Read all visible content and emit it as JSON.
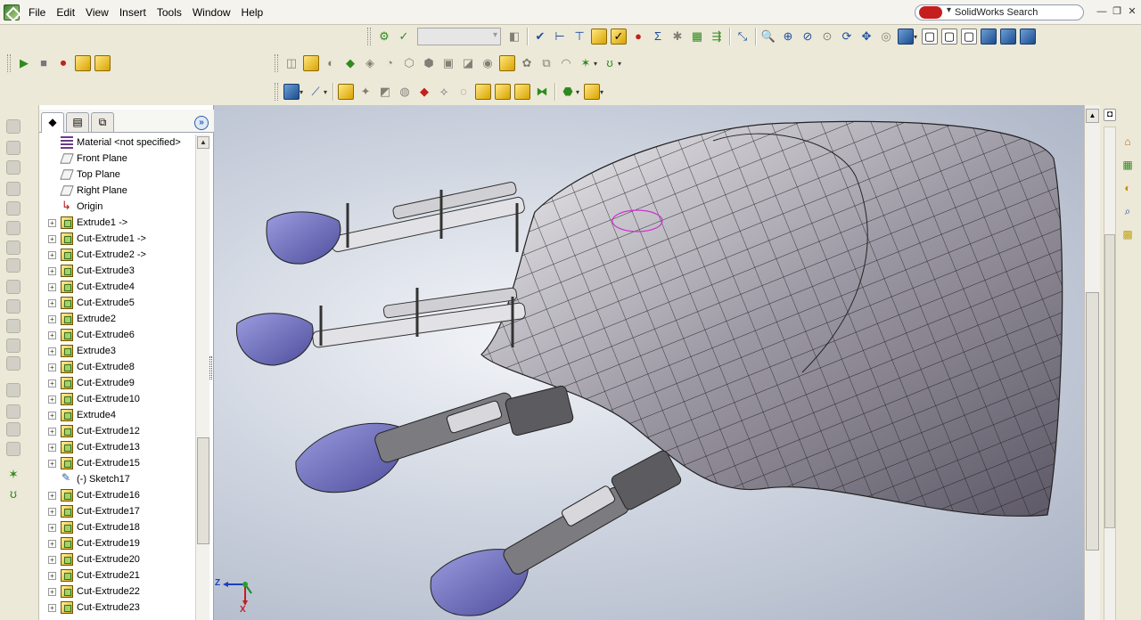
{
  "menu": {
    "items": [
      "File",
      "Edit",
      "View",
      "Insert",
      "Tools",
      "Window",
      "Help"
    ],
    "search_placeholder": "SolidWorks Search"
  },
  "window_controls": {
    "minimize": "—",
    "restore": "❐",
    "close": "✕"
  },
  "toolbar": {
    "configuration_combo": ""
  },
  "feature_tree": {
    "items": [
      {
        "label": "Material <not specified>",
        "icon": "material-icon",
        "expandable": false
      },
      {
        "label": "Front Plane",
        "icon": "plane-icon",
        "expandable": false
      },
      {
        "label": "Top Plane",
        "icon": "plane-icon",
        "expandable": false
      },
      {
        "label": "Right Plane",
        "icon": "plane-icon",
        "expandable": false
      },
      {
        "label": "Origin",
        "icon": "origin-icon",
        "expandable": false
      },
      {
        "label": "Extrude1 ->",
        "icon": "extrude-icon",
        "expandable": true
      },
      {
        "label": "Cut-Extrude1 ->",
        "icon": "cut-extrude-icon",
        "expandable": true
      },
      {
        "label": "Cut-Extrude2 ->",
        "icon": "cut-extrude-icon",
        "expandable": true
      },
      {
        "label": "Cut-Extrude3",
        "icon": "cut-extrude-icon",
        "expandable": true
      },
      {
        "label": "Cut-Extrude4",
        "icon": "cut-extrude-icon",
        "expandable": true
      },
      {
        "label": "Cut-Extrude5",
        "icon": "cut-extrude-icon",
        "expandable": true
      },
      {
        "label": "Extrude2",
        "icon": "extrude-icon",
        "expandable": true
      },
      {
        "label": "Cut-Extrude6",
        "icon": "cut-extrude-icon",
        "expandable": true
      },
      {
        "label": "Extrude3",
        "icon": "extrude-icon",
        "expandable": true
      },
      {
        "label": "Cut-Extrude8",
        "icon": "cut-extrude-icon",
        "expandable": true
      },
      {
        "label": "Cut-Extrude9",
        "icon": "cut-extrude-icon",
        "expandable": true
      },
      {
        "label": "Cut-Extrude10",
        "icon": "cut-extrude-icon",
        "expandable": true
      },
      {
        "label": "Extrude4",
        "icon": "extrude-icon",
        "expandable": true
      },
      {
        "label": "Cut-Extrude12",
        "icon": "cut-extrude-icon",
        "expandable": true
      },
      {
        "label": "Cut-Extrude13",
        "icon": "cut-extrude-icon",
        "expandable": true
      },
      {
        "label": "Cut-Extrude15",
        "icon": "cut-extrude-icon",
        "expandable": true
      },
      {
        "label": "(-) Sketch17",
        "icon": "sketch-icon",
        "expandable": false
      },
      {
        "label": "Cut-Extrude16",
        "icon": "cut-extrude-icon",
        "expandable": true
      },
      {
        "label": "Cut-Extrude17",
        "icon": "cut-extrude-icon",
        "expandable": true
      },
      {
        "label": "Cut-Extrude18",
        "icon": "cut-extrude-icon",
        "expandable": true
      },
      {
        "label": "Cut-Extrude19",
        "icon": "cut-extrude-icon",
        "expandable": true
      },
      {
        "label": "Cut-Extrude20",
        "icon": "cut-extrude-icon",
        "expandable": true
      },
      {
        "label": "Cut-Extrude21",
        "icon": "cut-extrude-icon",
        "expandable": true
      },
      {
        "label": "Cut-Extrude22",
        "icon": "cut-extrude-icon",
        "expandable": true
      },
      {
        "label": "Cut-Extrude23",
        "icon": "cut-extrude-icon",
        "expandable": true
      }
    ]
  },
  "triad": {
    "z_label": "Z",
    "x_label": "X"
  },
  "colors": {
    "accent_blue": "#1b4fa0",
    "viewport_background": "#cfd5e0",
    "fingertip_purple": "#7f7fd0"
  }
}
